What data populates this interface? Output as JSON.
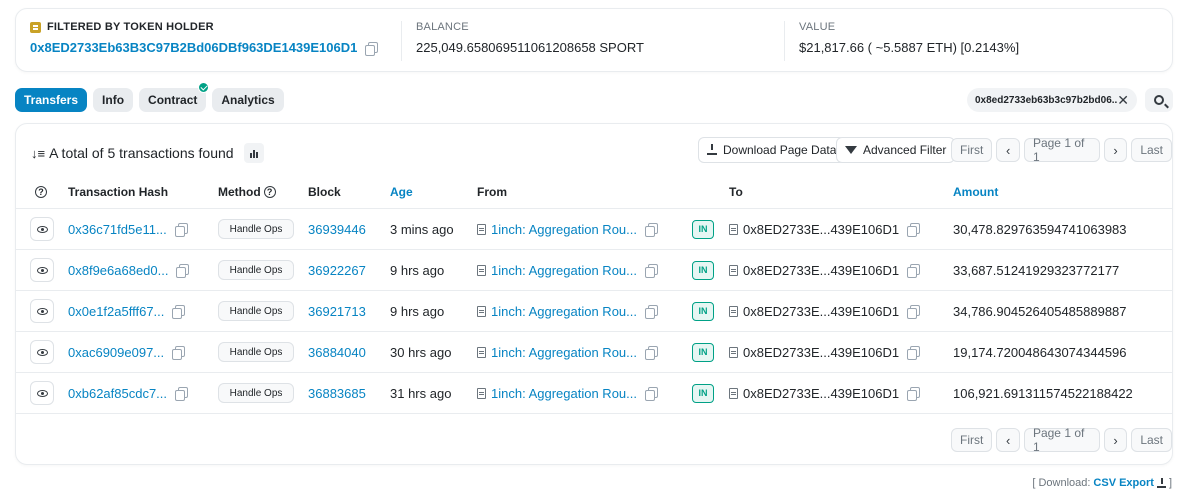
{
  "summary": {
    "filter_label": "FILTERED BY TOKEN HOLDER",
    "holder_address": "0x8ED2733Eb63B3C97B2Bd06DBf963DE1439E106D1",
    "balance_label": "BALANCE",
    "balance_value": "225,049.658069511061208658 SPORT",
    "value_label": "VALUE",
    "value_value": "$21,817.66 ( ~5.5887 ETH) [0.2143%]"
  },
  "tabs": [
    {
      "label": "Transfers",
      "active": true
    },
    {
      "label": "Info"
    },
    {
      "label": "Contract",
      "verified": true
    },
    {
      "label": "Analytics"
    }
  ],
  "filter_chip": "0x8ed2733eb63b3c97b2bd06...",
  "toolbar": {
    "total_text": "A total of 5 transactions found",
    "download_label": "Download Page Data",
    "filter_label": "Advanced Filter",
    "first": "First",
    "page": "Page 1 of 1",
    "last": "Last"
  },
  "table": {
    "headers": {
      "hash": "Transaction Hash",
      "method": "Method",
      "block": "Block",
      "age": "Age",
      "from": "From",
      "to": "To",
      "amount": "Amount"
    },
    "rows": [
      {
        "hash": "0x36c71fd5e11...",
        "method": "Handle Ops",
        "block": "36939446",
        "age": "3 mins ago",
        "from": "1inch: Aggregation Rou...",
        "dir": "IN",
        "to": "0x8ED2733E...439E106D1",
        "amount": "30,478.829763594741063983"
      },
      {
        "hash": "0x8f9e6a68ed0...",
        "method": "Handle Ops",
        "block": "36922267",
        "age": "9 hrs ago",
        "from": "1inch: Aggregation Rou...",
        "dir": "IN",
        "to": "0x8ED2733E...439E106D1",
        "amount": "33,687.51241929323772177"
      },
      {
        "hash": "0x0e1f2a5fff67...",
        "method": "Handle Ops",
        "block": "36921713",
        "age": "9 hrs ago",
        "from": "1inch: Aggregation Rou...",
        "dir": "IN",
        "to": "0x8ED2733E...439E106D1",
        "amount": "34,786.904526405485889887"
      },
      {
        "hash": "0xac6909e097...",
        "method": "Handle Ops",
        "block": "36884040",
        "age": "30 hrs ago",
        "from": "1inch: Aggregation Rou...",
        "dir": "IN",
        "to": "0x8ED2733E...439E106D1",
        "amount": "19,174.720048643074344596"
      },
      {
        "hash": "0xb62af85cdc7...",
        "method": "Handle Ops",
        "block": "36883685",
        "age": "31 hrs ago",
        "from": "1inch: Aggregation Rou...",
        "dir": "IN",
        "to": "0x8ED2733E...439E106D1",
        "amount": "106,921.691311574522188422"
      }
    ]
  },
  "footer": {
    "prefix": "[ Download:",
    "link": "CSV Export",
    "suffix": "]"
  },
  "colors": {
    "accent": "#0784c3",
    "in_badge": "#00a186"
  }
}
